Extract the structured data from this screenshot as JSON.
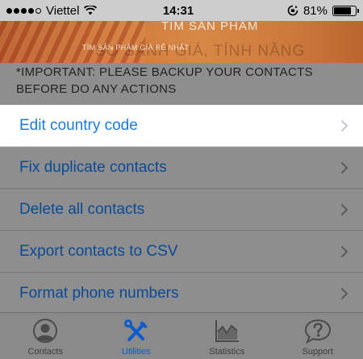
{
  "status_bar": {
    "carrier": "Viettel",
    "time": "14:31",
    "battery_percent": "81%",
    "battery_level": 0.81,
    "signal_bars_filled": 4,
    "signal_bars_total": 5
  },
  "banner": {
    "title": "TÌM SẢN PHẨM",
    "subtitle": "TÌM SẢN PHẨM GIÁ RẺ NHẤT",
    "faded_text": "SO SÁNH GIÁ, TÍNH NĂNG"
  },
  "warning": {
    "text": "*IMPORTANT: PLEASE BACKUP YOUR CONTACTS BEFORE DO ANY ACTIONS"
  },
  "utilities": {
    "items": [
      {
        "label": "Edit country code",
        "selected": true
      },
      {
        "label": "Fix duplicate contacts",
        "selected": false
      },
      {
        "label": "Delete all contacts",
        "selected": false
      },
      {
        "label": "Export contacts to CSV",
        "selected": false
      },
      {
        "label": "Format phone numbers",
        "selected": false
      }
    ]
  },
  "tab_bar": {
    "tabs": [
      {
        "label": "Contacts",
        "icon": "person-icon",
        "active": false
      },
      {
        "label": "Utilities",
        "icon": "tools-icon",
        "active": true
      },
      {
        "label": "Statistics",
        "icon": "chart-icon",
        "active": false
      },
      {
        "label": "Support",
        "icon": "question-bubble-icon",
        "active": false
      }
    ]
  },
  "colors": {
    "accent": "#1a7ae0",
    "list_text_dim": "#0a4a96",
    "overlay": "#8e8e8e",
    "banner": "#d88846"
  }
}
